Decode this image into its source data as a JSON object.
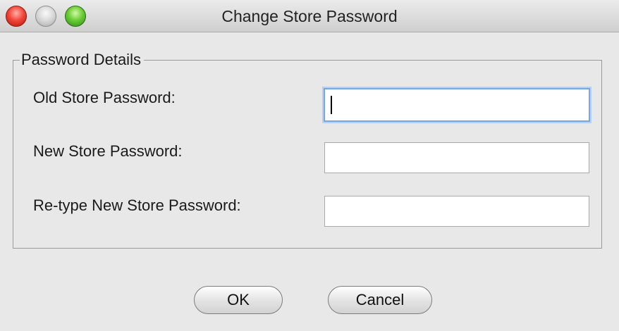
{
  "window": {
    "title": "Change Store Password"
  },
  "titlebar": {
    "buttons": [
      "close",
      "minimize",
      "zoom"
    ]
  },
  "form": {
    "group_label": "Password Details",
    "fields": [
      {
        "label": "Old Store Password:",
        "value": "",
        "focused": true
      },
      {
        "label": "New Store Password:",
        "value": ""
      },
      {
        "label": "Re-type New Store Password:",
        "value": ""
      }
    ]
  },
  "actions": {
    "ok_label": "OK",
    "cancel_label": "Cancel"
  },
  "colors": {
    "close": "#f2473b",
    "minimize": "#d6d6d6",
    "zoom": "#6acd36",
    "focus_ring": "#7aa7e8"
  }
}
